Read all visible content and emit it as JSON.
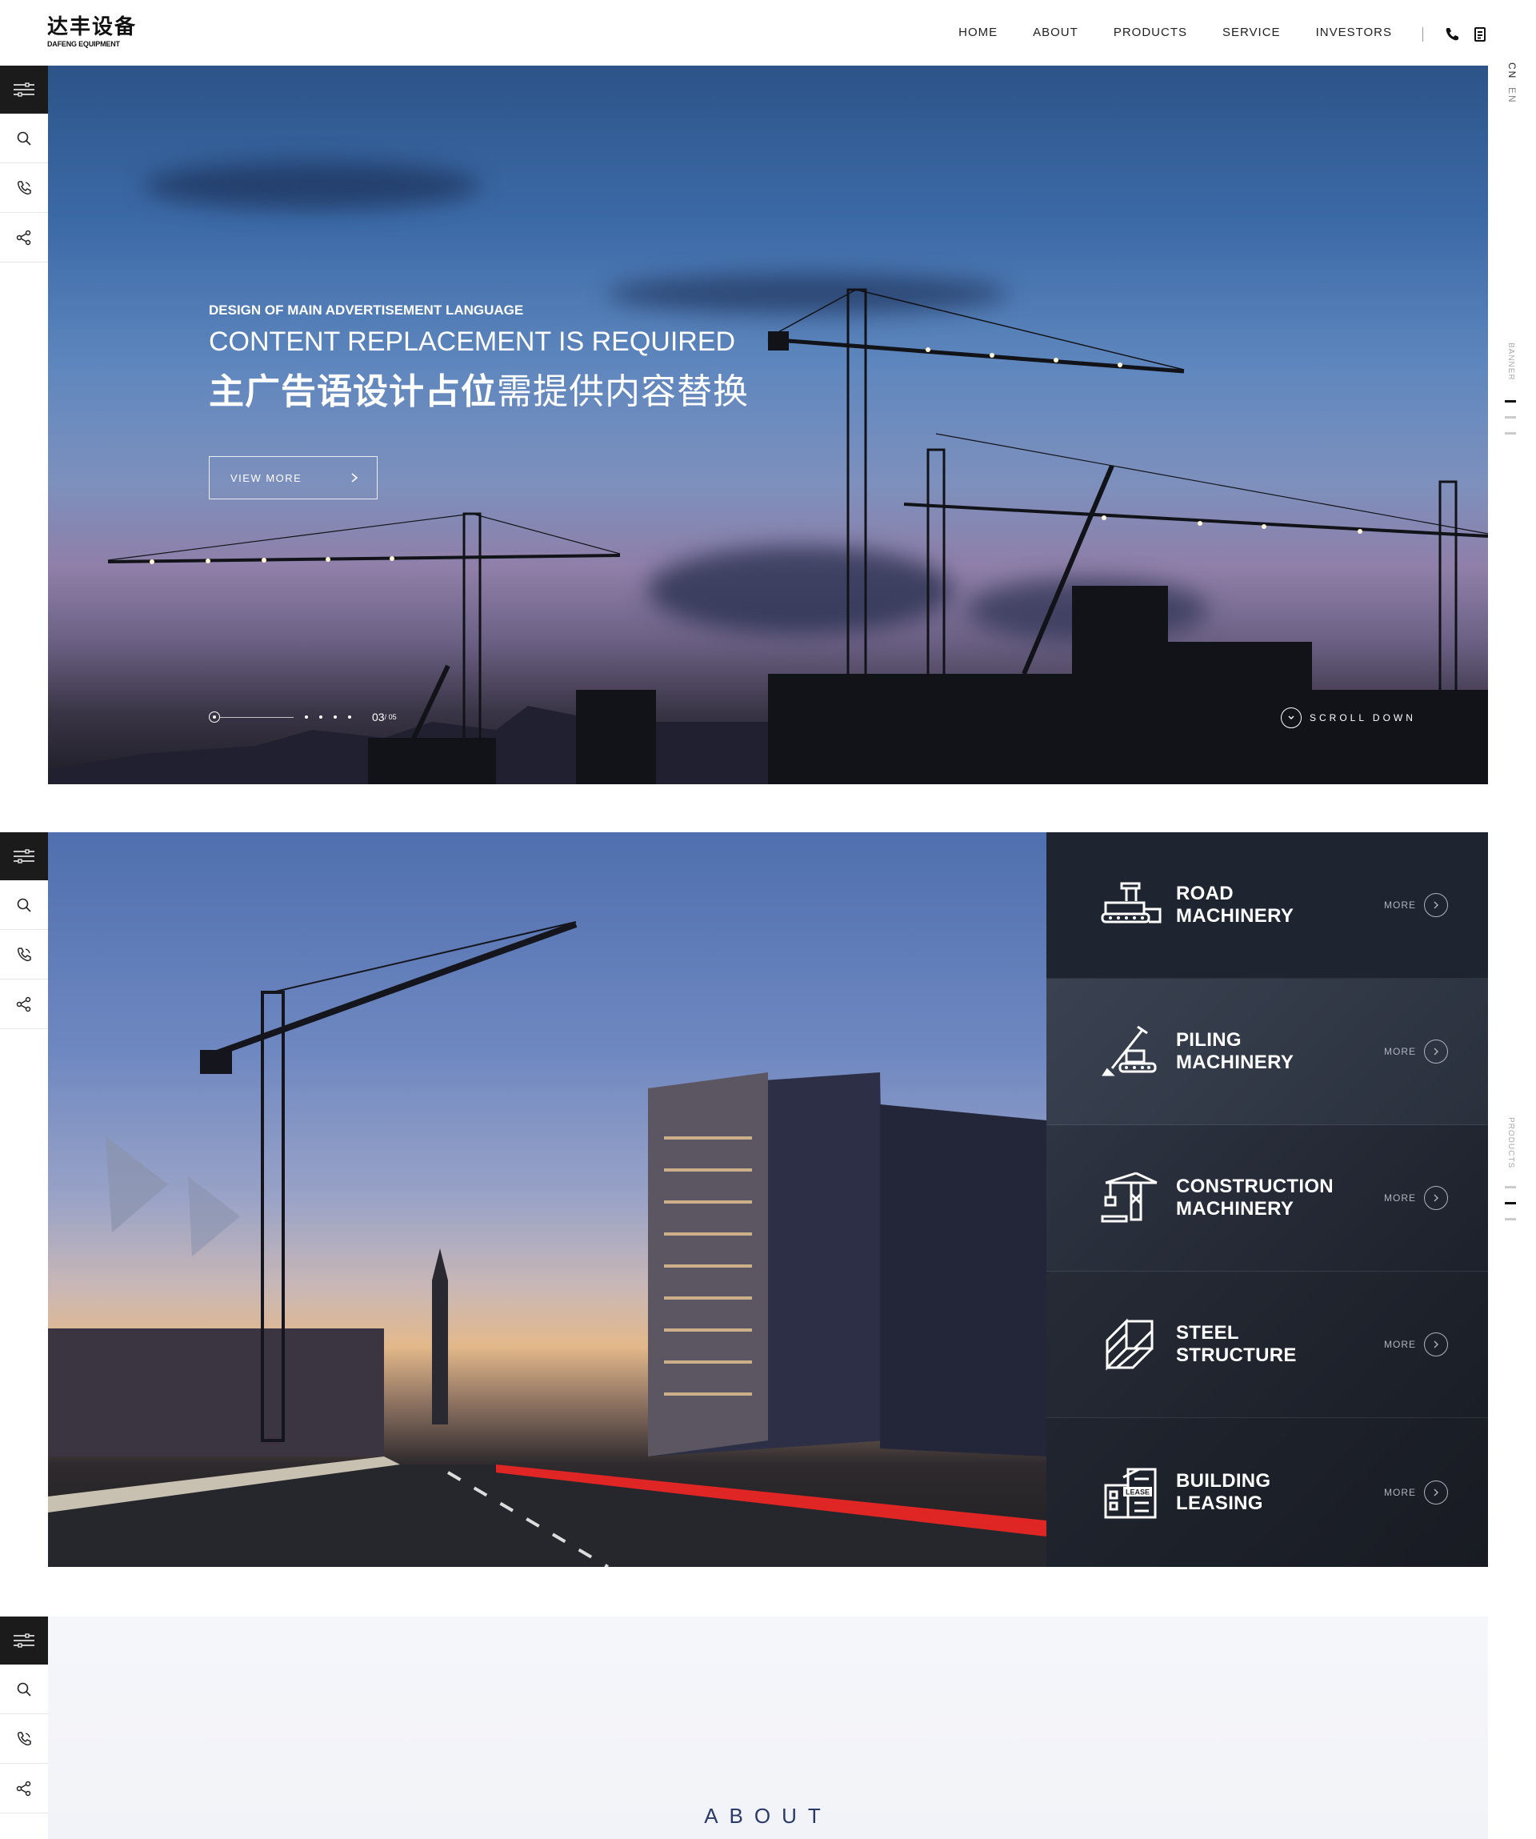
{
  "header": {
    "logo_cn": "达丰设备",
    "logo_en": "DAFENG EQUIPMENT",
    "nav": [
      "HOME",
      "ABOUT",
      "PRODUCTS",
      "SERVICE",
      "INVESTORS"
    ]
  },
  "lang": {
    "cn": "CN",
    "en": "EN"
  },
  "rail": {
    "banner_label": "BANNER",
    "products_label": "PRODUCTS"
  },
  "hero": {
    "small": "DESIGN OF MAIN ADVERTISEMENT LANGUAGE",
    "big": "CONTENT REPLACEMENT IS REQUIRED",
    "cn_bold": "主广告语设计占位",
    "cn_light": "需提供内容替换",
    "button": "VIEW MORE",
    "page_current": "03",
    "page_total": "/ 05",
    "scroll": "SCROLL DOWN"
  },
  "products": {
    "items": [
      {
        "line1": "ROAD",
        "line2": "MACHINERY",
        "more": "MORE",
        "icon": "road-machinery-icon"
      },
      {
        "line1": "PILING",
        "line2": "MACHINERY",
        "more": "MORE",
        "icon": "piling-machinery-icon"
      },
      {
        "line1": "CONSTRUCTION",
        "line2": "MACHINERY",
        "more": "MORE",
        "icon": "construction-crane-icon"
      },
      {
        "line1": "STEEL",
        "line2": "STRUCTURE",
        "more": "MORE",
        "icon": "steel-structure-icon"
      },
      {
        "line1": "BUILDING",
        "line2": "LEASING",
        "more": "MORE",
        "icon": "building-lease-icon",
        "badge": "LEASE"
      }
    ]
  },
  "about": {
    "title": "ABOUT"
  },
  "colors": {
    "dark_panel": "#1f2530",
    "accent_navy": "#2a3a66",
    "toolbar": "#1b1b1b"
  }
}
